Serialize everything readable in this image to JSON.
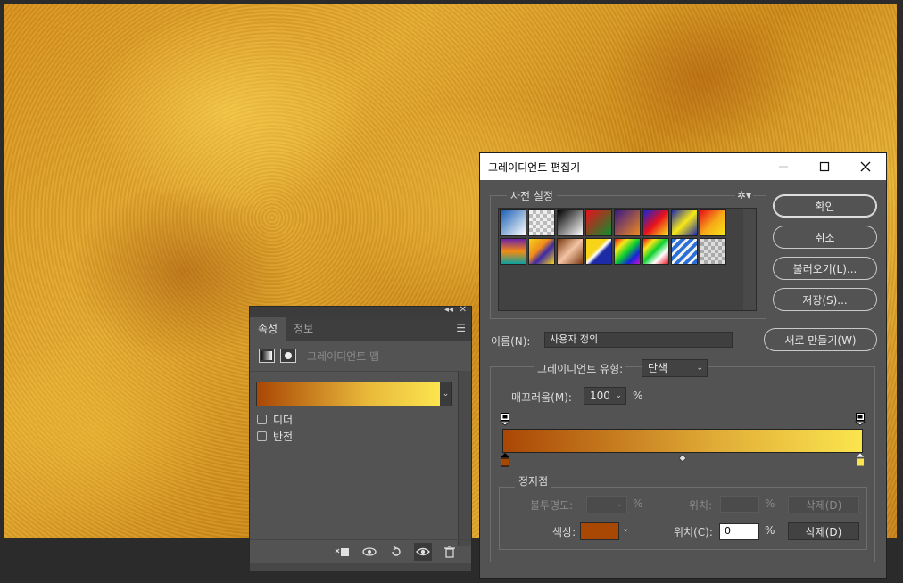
{
  "properties_panel": {
    "tabs": [
      "속성",
      "정보"
    ],
    "adjustment_label": "그레이디언트 맵",
    "gradient": {
      "start_color": "#a94705",
      "mid_color": "#e9b83a",
      "end_color": "#fbe54e"
    },
    "options": [
      "디더",
      "반전"
    ],
    "footer_icons": [
      "clip-to-layer-icon",
      "view-previous-state-icon",
      "reset-icon",
      "visibility-eye-icon",
      "trash-icon"
    ]
  },
  "dialog": {
    "title": "그레이디언트 편집기",
    "presets_label": "사전 설정",
    "buttons": {
      "ok": "확인",
      "cancel": "취소",
      "load": "불러오기(L)...",
      "save": "저장(S)...",
      "new": "새로 만들기(W)"
    },
    "name_label": "이름(N):",
    "name_value": "사용자 정의",
    "gradient_type_label": "그레이디언트 유형:",
    "gradient_type_value": "단색",
    "smoothness_label": "매끄러움(M):",
    "smoothness_value": "100",
    "percent": "%",
    "stops_section": "정지점",
    "opacity_label": "불투명도:",
    "location_label_dim": "위치:",
    "delete_label": "삭제(D)",
    "color_label": "색상:",
    "color_value": "#a94705",
    "location_label": "위치(C):",
    "location_value": "0",
    "colors": {
      "start": "#a94705",
      "end": "#fbe54e",
      "accent_mid": "#e1ad37"
    }
  }
}
